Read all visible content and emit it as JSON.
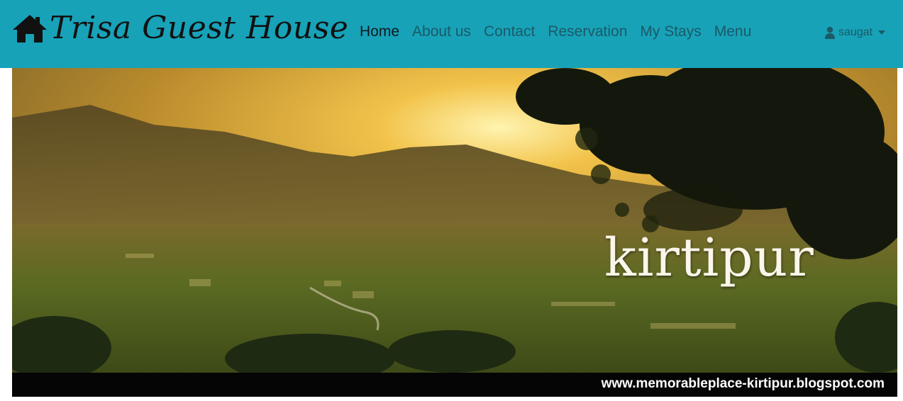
{
  "brand": {
    "title": "Trisa Guest House",
    "icon": "home-icon"
  },
  "nav": {
    "items": [
      {
        "label": "Home",
        "active": true
      },
      {
        "label": "About us",
        "active": false
      },
      {
        "label": "Contact",
        "active": false
      },
      {
        "label": "Reservation",
        "active": false
      },
      {
        "label": "My Stays",
        "active": false
      },
      {
        "label": "Menu",
        "active": false
      }
    ]
  },
  "user": {
    "name": "saugat",
    "icon": "user-icon"
  },
  "hero": {
    "title": "kirtipur",
    "url": "www.memorableplace-kirtipur.blogspot.com"
  },
  "colors": {
    "navbar": "#17a2b8",
    "nav_text": "#1b5a66",
    "active_text": "#0d1a1d"
  }
}
